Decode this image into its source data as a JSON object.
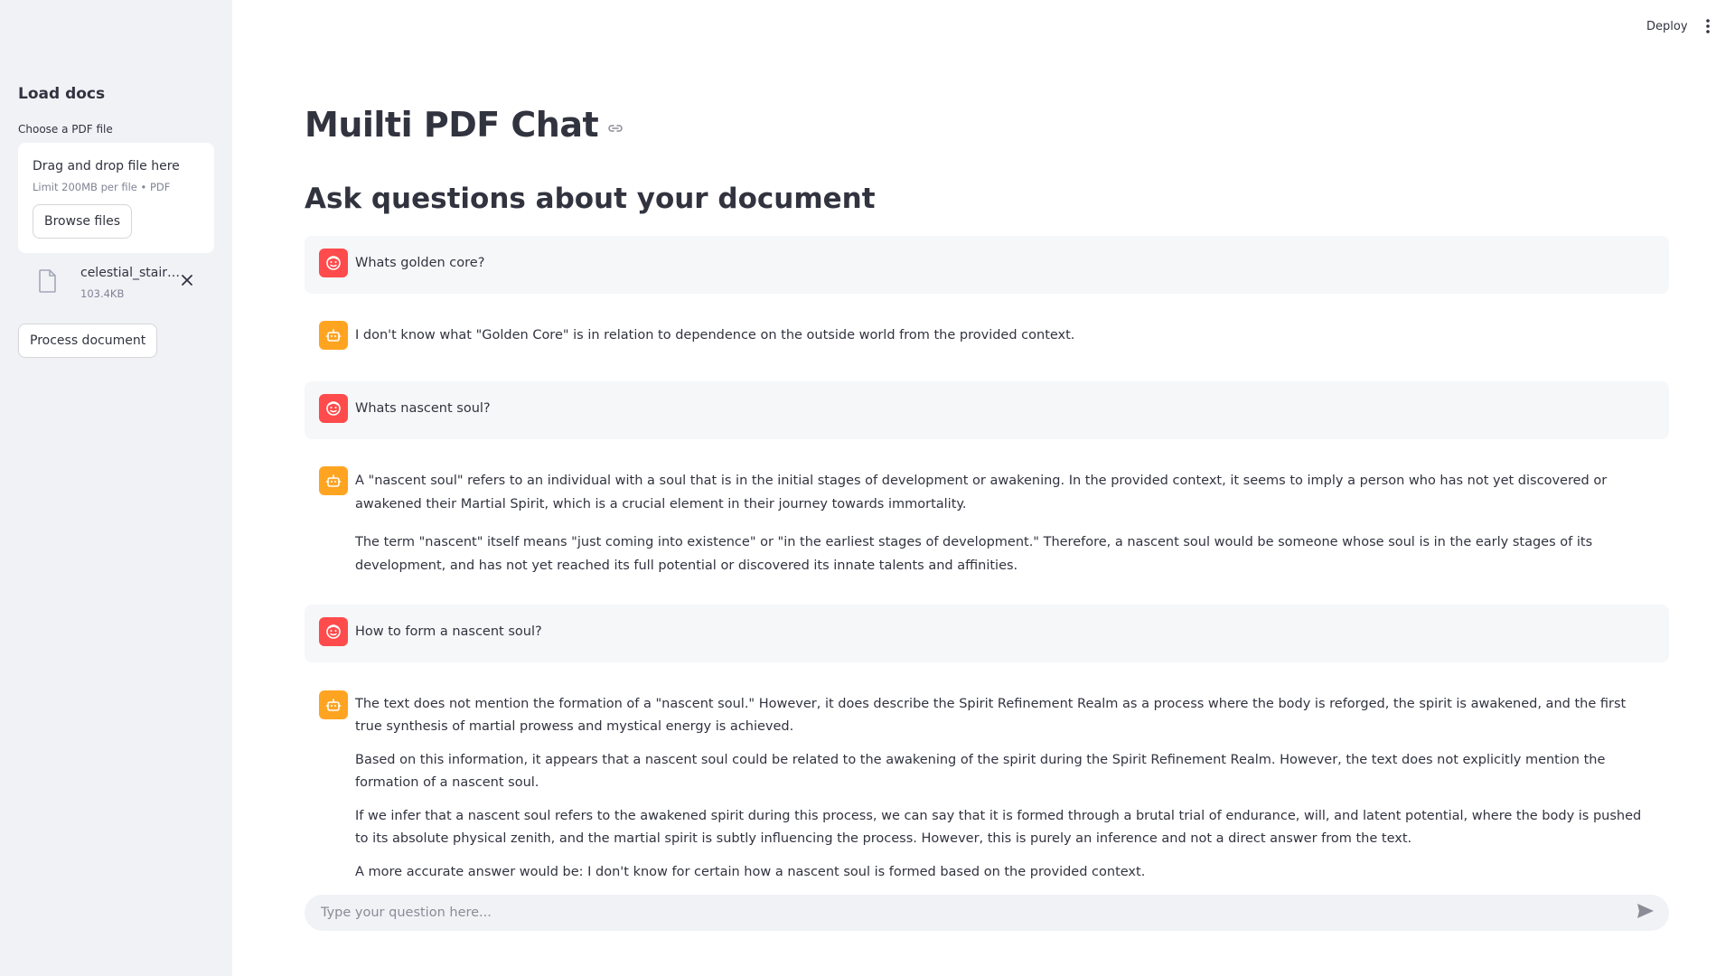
{
  "sidebar": {
    "header": "Load docs",
    "uploader_label": "Choose a PDF file",
    "dropzone_title": "Drag and drop file here",
    "dropzone_limit": "Limit 200MB per file • PDF",
    "browse_label": "Browse files",
    "file": {
      "name": "celestial_stair…",
      "size": "103.4KB"
    },
    "process_label": "Process document"
  },
  "toolbar": {
    "deploy_label": "Deploy"
  },
  "main": {
    "title": "Muilti PDF Chat",
    "subtitle": "Ask questions about your document"
  },
  "messages": [
    {
      "role": "user",
      "icon": "user-face-icon",
      "paragraphs": [
        "Whats golden core?"
      ]
    },
    {
      "role": "assistant",
      "icon": "robot-icon",
      "paragraphs": [
        "I don't know what \"Golden Core\" is in relation to dependence on the outside world from the provided context."
      ]
    },
    {
      "role": "user",
      "icon": "user-face-icon",
      "paragraphs": [
        "Whats nascent soul?"
      ]
    },
    {
      "role": "assistant",
      "icon": "robot-icon",
      "paragraphs": [
        "A \"nascent soul\" refers to an individual with a soul that is in the initial stages of development or awakening. In the provided context, it seems to imply a person who has not yet discovered or awakened their Martial Spirit, which is a crucial element in their journey towards immortality.",
        "The term \"nascent\" itself means \"just coming into existence\" or \"in the earliest stages of development.\" Therefore, a nascent soul would be someone whose soul is in the early stages of its development, and has not yet reached its full potential or discovered its innate talents and affinities."
      ]
    },
    {
      "role": "user",
      "icon": "user-face-icon",
      "paragraphs": [
        "How to form a nascent soul?"
      ]
    },
    {
      "role": "assistant",
      "icon": "robot-icon",
      "paragraphs": [
        "The text does not mention the formation of a \"nascent soul.\" However, it does describe the Spirit Refinement Realm as a process where the body is reforged, the spirit is awakened, and the first true synthesis of martial prowess and mystical energy is achieved.",
        "Based on this information, it appears that a nascent soul could be related to the awakening of the spirit during the Spirit Refinement Realm. However, the text does not explicitly mention the formation of a nascent soul.",
        "If we infer that a nascent soul refers to the awakened spirit during this process, we can say that it is formed through a brutal trial of endurance, will, and latent potential, where the body is pushed to its absolute physical zenith, and the martial spirit is subtly influencing the process. However, this is purely an inference and not a direct answer from the text.",
        "A more accurate answer would be: I don't know for certain how a nascent soul is formed based on the provided context."
      ]
    }
  ],
  "chat_input": {
    "placeholder": "Type your question here..."
  },
  "colors": {
    "user_avatar": "#FF4B4B",
    "assistant_avatar": "#FFA421",
    "sidebar_bg": "#F0F2F6",
    "user_message_bg": "#F6F7F9"
  }
}
